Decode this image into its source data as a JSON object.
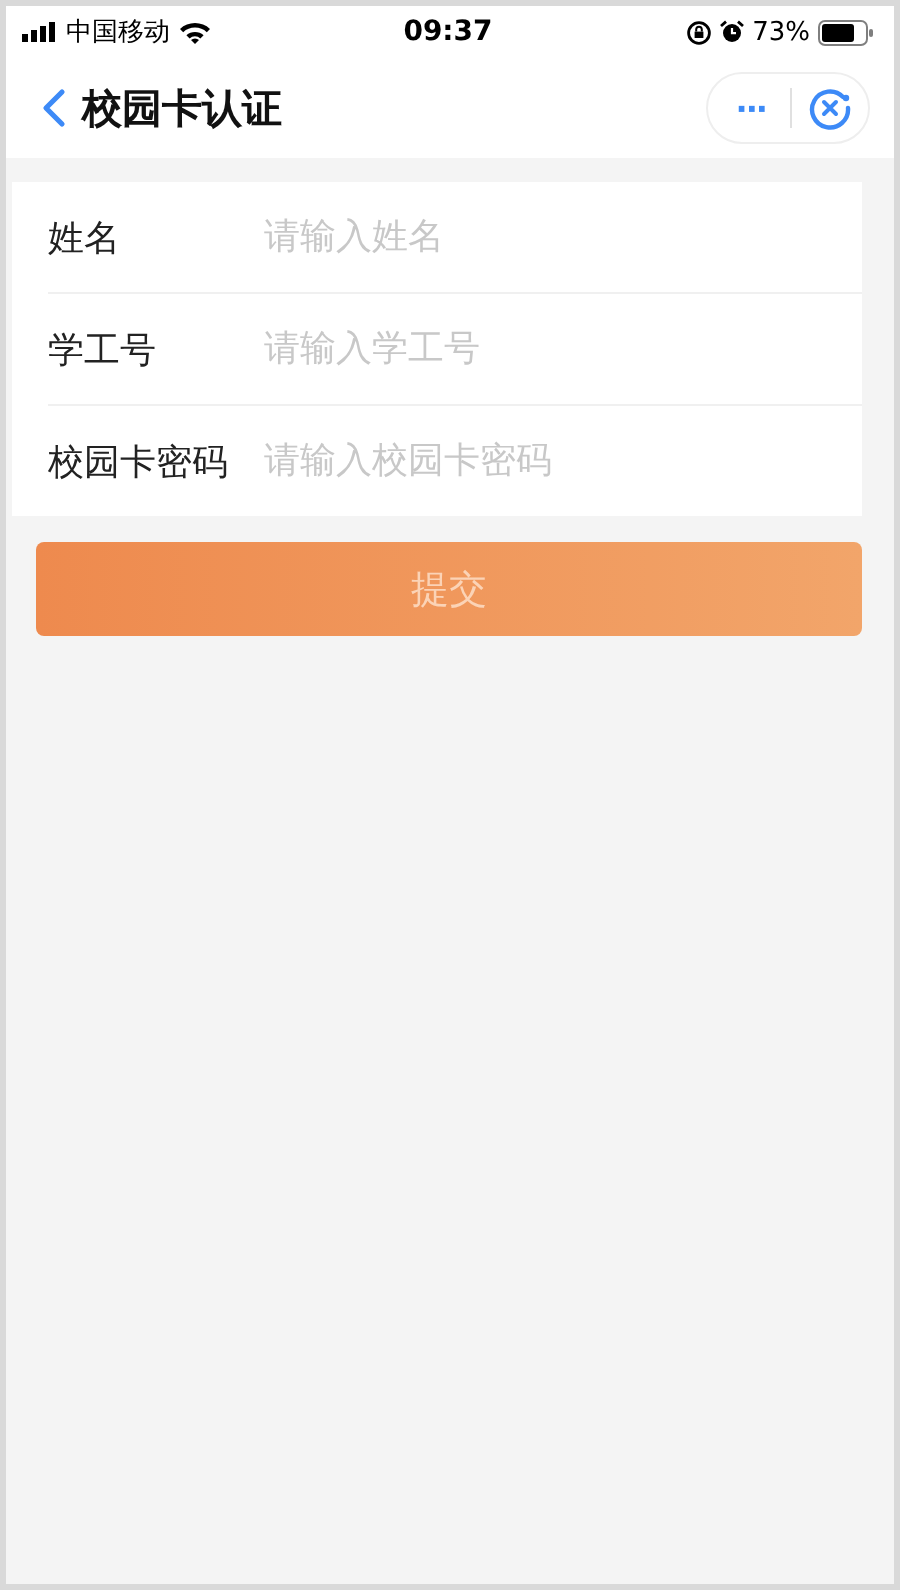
{
  "status_bar": {
    "carrier": "中国移动",
    "time": "09:37",
    "battery": "73%"
  },
  "nav": {
    "title": "校园卡认证",
    "more": "···"
  },
  "form": {
    "fields": [
      {
        "label": "姓名",
        "placeholder": "请输入姓名"
      },
      {
        "label": "学工号",
        "placeholder": "请输入学工号"
      },
      {
        "label": "校园卡密码",
        "placeholder": "请输入校园卡密码"
      }
    ]
  },
  "submit": {
    "label": "提交",
    "disabled": true
  }
}
